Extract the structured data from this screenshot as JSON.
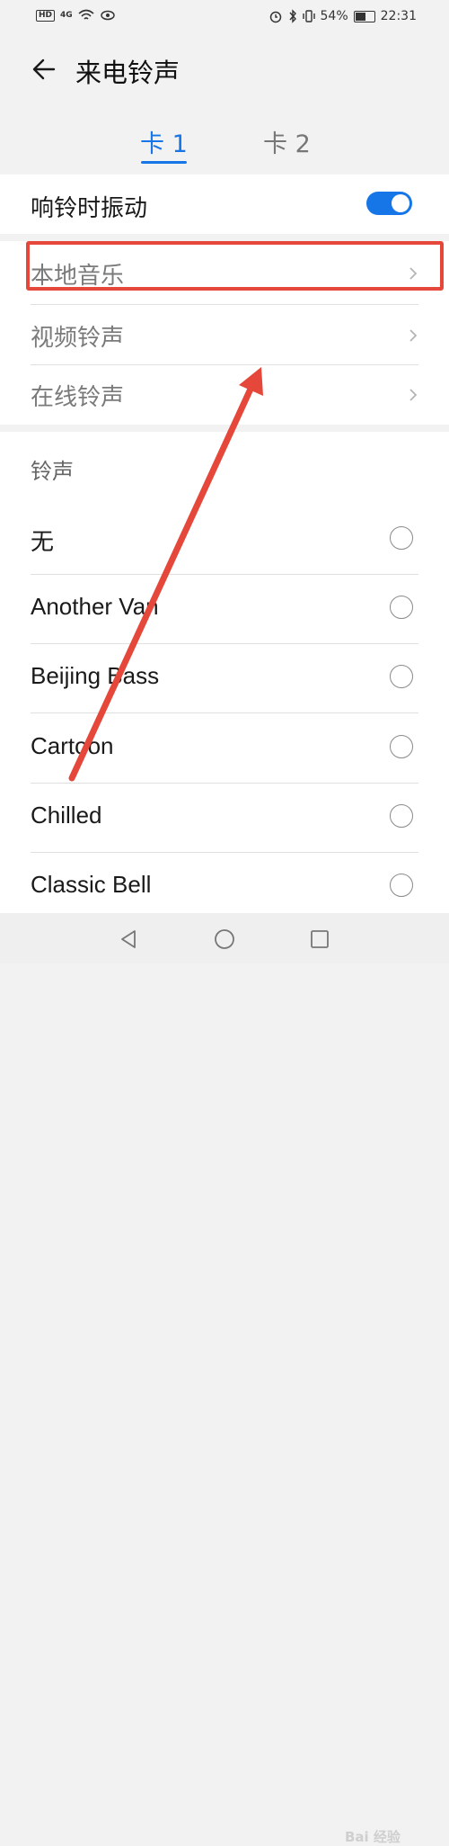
{
  "status_bar": {
    "hd_badge": "HD",
    "network": "4G",
    "battery": "54%",
    "time": "22:31",
    "battery_level": 0.54
  },
  "header": {
    "back_icon": "back-arrow-icon",
    "title": "来电铃声"
  },
  "tabs": [
    {
      "label": "卡 1",
      "selected": true
    },
    {
      "label": "卡 2",
      "selected": false
    }
  ],
  "vibrate": {
    "label": "响铃时振动",
    "enabled": true
  },
  "sources": [
    {
      "label": "本地音乐"
    },
    {
      "label": "视频铃声"
    },
    {
      "label": "在线铃声"
    }
  ],
  "ringtones": {
    "section_title": "铃声",
    "items": [
      {
        "label": "无"
      },
      {
        "label": "Another Van"
      },
      {
        "label": "Beijing Bass"
      },
      {
        "label": "Cartoon"
      },
      {
        "label": "Chilled"
      },
      {
        "label": "Classic Bell"
      }
    ]
  },
  "nav_bar": {
    "back": "nav-back-icon",
    "home": "nav-home-icon",
    "recent": "nav-recent-icon"
  },
  "watermark": "Bai 经验",
  "colors": {
    "accent": "#1676e8",
    "annotation": "#e5473a"
  }
}
